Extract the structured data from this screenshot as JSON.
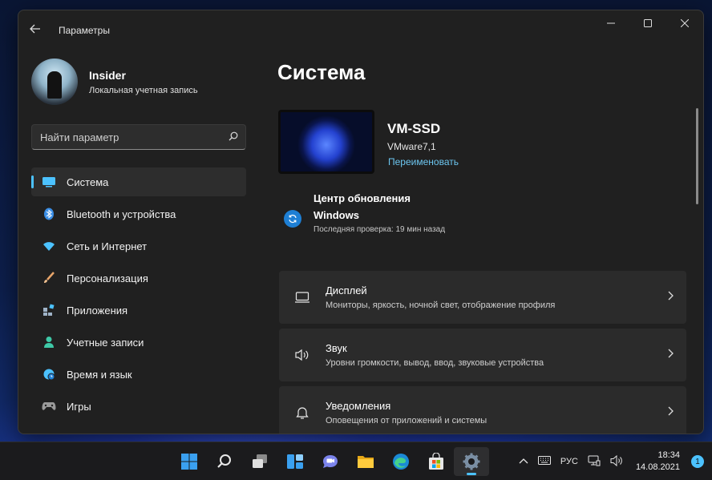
{
  "window": {
    "app_title": "Параметры",
    "controls": {
      "minimize": "—",
      "maximize": "☐",
      "close": "✕"
    }
  },
  "profile": {
    "name": "Insider",
    "account_type": "Локальная учетная запись"
  },
  "search": {
    "placeholder": "Найти параметр"
  },
  "sidebar": {
    "items": [
      {
        "label": "Система",
        "icon": "monitor-icon",
        "color": "#4cc2ff",
        "active": true
      },
      {
        "label": "Bluetooth и устройства",
        "icon": "bluetooth-icon",
        "color": "#3a8ee6"
      },
      {
        "label": "Сеть и Интернет",
        "icon": "wifi-icon",
        "color": "#4cc2ff"
      },
      {
        "label": "Персонализация",
        "icon": "brush-icon",
        "color": "#e8a56a"
      },
      {
        "label": "Приложения",
        "icon": "apps-icon",
        "color": "#9fb3c8"
      },
      {
        "label": "Учетные записи",
        "icon": "person-icon",
        "color": "#3ec9a7"
      },
      {
        "label": "Время и язык",
        "icon": "globe-clock-icon",
        "color": "#4cc2ff"
      },
      {
        "label": "Игры",
        "icon": "gamepad-icon",
        "color": "#9a9a9a"
      }
    ]
  },
  "main": {
    "title": "Система",
    "device": {
      "name": "VM-SSD",
      "model": "VMware7,1",
      "rename_label": "Переименовать"
    },
    "update": {
      "title": "Центр обновления Windows",
      "last_check": "Последняя проверка: 19 мин назад"
    },
    "cards": [
      {
        "title": "Дисплей",
        "subtitle": "Мониторы, яркость, ночной свет, отображение профиля",
        "icon": "display-icon"
      },
      {
        "title": "Звук",
        "subtitle": "Уровни громкости, вывод, ввод, звуковые устройства",
        "icon": "speaker-icon"
      },
      {
        "title": "Уведомления",
        "subtitle": "Оповещения от приложений и системы",
        "icon": "bell-icon"
      }
    ]
  },
  "taskbar": {
    "apps": [
      "start-icon",
      "search-icon",
      "task-view-icon",
      "widgets-icon",
      "teams-chat-icon",
      "file-explorer-icon",
      "edge-icon",
      "store-icon",
      "settings-icon"
    ],
    "active_app": "settings-icon",
    "language": "РУС",
    "time": "18:34",
    "date": "14.08.2021",
    "notification_count": "1"
  },
  "colors": {
    "accent": "#4cc2ff",
    "window_bg": "#202020",
    "card_bg": "#2b2b2b",
    "link": "#6cc6f0"
  }
}
